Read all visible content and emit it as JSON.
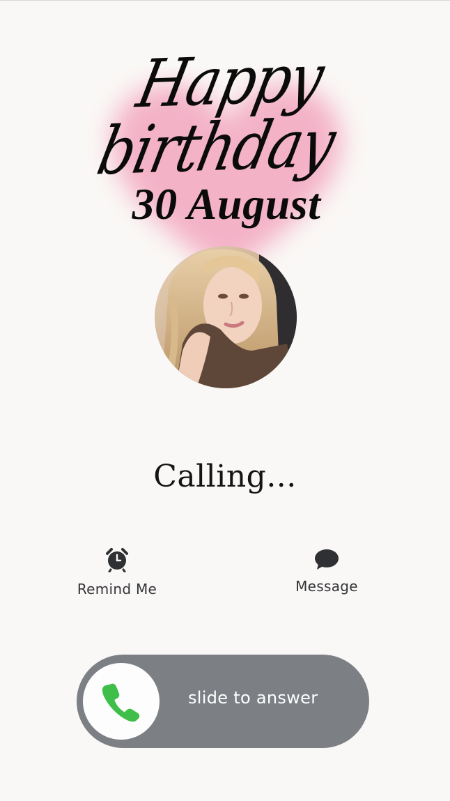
{
  "header": {
    "greeting": "Happy birthday",
    "date": "30 August"
  },
  "caller": {
    "status": "Calling..."
  },
  "actions": {
    "remind_label": "Remind Me",
    "message_label": "Message"
  },
  "answer": {
    "slider_text": "slide to answer"
  },
  "icons": {
    "remind": "alarm-clock-icon",
    "message": "speech-bubble-icon",
    "answer": "phone-icon"
  },
  "colors": {
    "background": "#faf8f6",
    "heart_pink": "#f3a6bf",
    "slider_track": "#7c8085",
    "phone_green": "#3fbf4a",
    "text_dark": "#0b0b0b"
  }
}
